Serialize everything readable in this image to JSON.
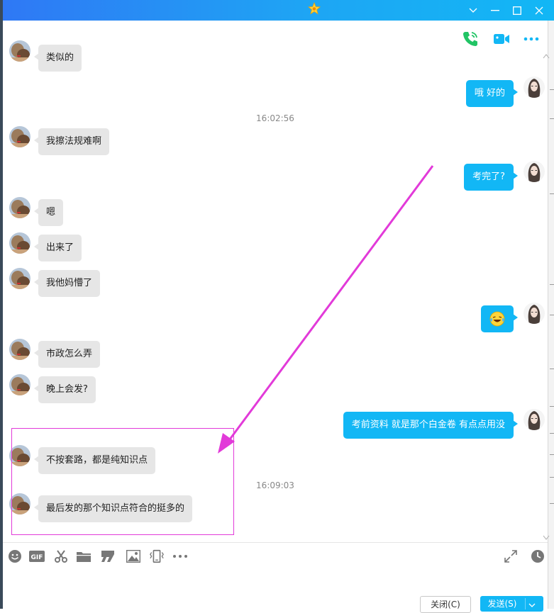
{
  "window": {
    "accent": "#12b7f5",
    "titlebar_gradient": [
      "#2f78f5",
      "#12b7f5"
    ]
  },
  "header": {
    "icons": [
      "phone-call-icon",
      "video-call-icon",
      "more-icon"
    ]
  },
  "messages": [
    {
      "side": "left",
      "text": "类似的"
    },
    {
      "side": "right",
      "text": "哦  好的"
    },
    {
      "type": "timestamp",
      "text": "16:02:56"
    },
    {
      "side": "left",
      "text": "我擦法规难啊"
    },
    {
      "side": "right",
      "text": "考完了?"
    },
    {
      "side": "left",
      "text": "嗯"
    },
    {
      "side": "left",
      "text": "出来了"
    },
    {
      "side": "left",
      "text": "我他妈懵了"
    },
    {
      "side": "right",
      "emoji": "laughing-tears-emoji"
    },
    {
      "side": "left",
      "text": "市政怎么弄"
    },
    {
      "side": "left",
      "text": "晚上会发?"
    },
    {
      "side": "right",
      "text": "考前资料 就是那个白金卷 有点点用没"
    },
    {
      "side": "left",
      "text": "不按套路，都是纯知识点"
    },
    {
      "type": "timestamp",
      "text": "16:09:03"
    },
    {
      "side": "left",
      "text": "最后发的那个知识点符合的挺多的"
    }
  ],
  "annotation": {
    "color": "#e23ad9"
  },
  "toolbar": {
    "items": [
      "emoji-icon",
      "gif-icon",
      "scissors-icon",
      "folder-icon",
      "quote-icon",
      "image-icon",
      "shake-icon",
      "more-icon"
    ],
    "right": [
      "expand-icon",
      "history-clock-icon"
    ]
  },
  "footer": {
    "close_label": "关闭(C)",
    "send_label": "发送(S)"
  }
}
